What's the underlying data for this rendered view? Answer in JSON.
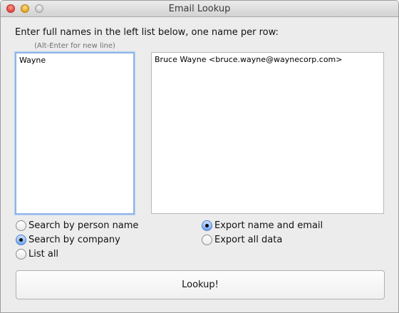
{
  "window": {
    "title": "Email Lookup"
  },
  "instructions": "Enter full names in the left list below, one name per row:",
  "hint": "(Alt-Enter for new line)",
  "names_list": {
    "value": "Wayne"
  },
  "results_list": {
    "value": "Bruce Wayne <bruce.wayne@waynecorp.com>"
  },
  "search_options": [
    {
      "label": "Search by person name",
      "checked": false
    },
    {
      "label": "Search by company",
      "checked": true
    },
    {
      "label": "List all",
      "checked": false
    }
  ],
  "export_options": [
    {
      "label": "Export name and email",
      "checked": true
    },
    {
      "label": "Export all data",
      "checked": false
    }
  ],
  "lookup_button": {
    "label": "Lookup!"
  },
  "colors": {
    "focus_ring": "#8fb4e8",
    "radio_selected": "#6fa2ec"
  }
}
